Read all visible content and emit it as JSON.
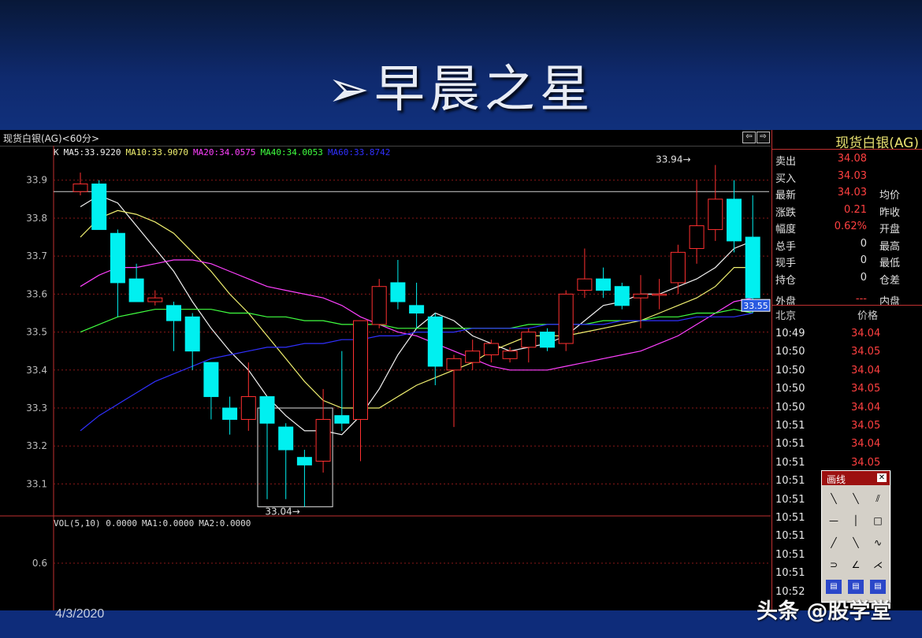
{
  "slide": {
    "title": "➢早晨之星",
    "date": "4/3/2020",
    "watermark": "头条 @股学堂"
  },
  "terminal": {
    "symbol_title": "现货白银(AG)<60分>",
    "nav_left_icon": "arrow-left-icon",
    "nav_right_icon": "arrow-right-icon",
    "ma_legend": [
      {
        "label": "K",
        "color": "#e0e0e0"
      },
      {
        "label": "MA5:33.9220",
        "color": "#f0f0f0"
      },
      {
        "label": "MA10:33.9070",
        "color": "#f0f070"
      },
      {
        "label": "MA20:34.0575",
        "color": "#ff40ff"
      },
      {
        "label": "MA40:34.0053",
        "color": "#40ff40"
      },
      {
        "label": "MA60:33.8742",
        "color": "#3030ff"
      }
    ],
    "vol_legend": [
      {
        "label": "VOL(5,10) 0.0000"
      },
      {
        "label": "MA1:0.0000"
      },
      {
        "label": "MA2:0.0000"
      }
    ],
    "last_price_tag": "33.55"
  },
  "chart_data": {
    "type": "candlestick",
    "title": "",
    "y_ticks": [
      33.9,
      33.8,
      33.7,
      33.6,
      33.5,
      33.4,
      33.3,
      33.2,
      33.1
    ],
    "ylim": [
      33.02,
      33.97
    ],
    "reference_price": 33.87,
    "annotations": [
      {
        "text": "33.94",
        "at_index": 33,
        "value": 33.94
      },
      {
        "text": "33.04",
        "at_index": 12,
        "value": 33.04
      }
    ],
    "candles": [
      {
        "o": 33.87,
        "h": 33.92,
        "l": 33.86,
        "c": 33.89
      },
      {
        "o": 33.89,
        "h": 33.9,
        "l": 33.77,
        "c": 33.77
      },
      {
        "o": 33.76,
        "h": 33.77,
        "l": 33.54,
        "c": 33.63
      },
      {
        "o": 33.64,
        "h": 33.68,
        "l": 33.58,
        "c": 33.58
      },
      {
        "o": 33.58,
        "h": 33.61,
        "l": 33.57,
        "c": 33.59
      },
      {
        "o": 33.57,
        "h": 33.58,
        "l": 33.45,
        "c": 33.53
      },
      {
        "o": 33.54,
        "h": 33.55,
        "l": 33.4,
        "c": 33.45
      },
      {
        "o": 33.42,
        "h": 33.42,
        "l": 33.27,
        "c": 33.33
      },
      {
        "o": 33.3,
        "h": 33.33,
        "l": 33.23,
        "c": 33.27
      },
      {
        "o": 33.27,
        "h": 33.42,
        "l": 33.24,
        "c": 33.33
      },
      {
        "o": 33.33,
        "h": 33.33,
        "l": 33.06,
        "c": 33.26
      },
      {
        "o": 33.25,
        "h": 33.26,
        "l": 33.06,
        "c": 33.19
      },
      {
        "o": 33.17,
        "h": 33.19,
        "l": 33.04,
        "c": 33.15
      },
      {
        "o": 33.16,
        "h": 33.35,
        "l": 33.13,
        "c": 33.27
      },
      {
        "o": 33.28,
        "h": 33.45,
        "l": 33.24,
        "c": 33.26
      },
      {
        "o": 33.27,
        "h": 33.53,
        "l": 33.16,
        "c": 33.53
      },
      {
        "o": 33.52,
        "h": 33.64,
        "l": 33.51,
        "c": 33.62
      },
      {
        "o": 33.63,
        "h": 33.69,
        "l": 33.56,
        "c": 33.58
      },
      {
        "o": 33.57,
        "h": 33.63,
        "l": 33.51,
        "c": 33.55
      },
      {
        "o": 33.54,
        "h": 33.55,
        "l": 33.36,
        "c": 33.41
      },
      {
        "o": 33.4,
        "h": 33.44,
        "l": 33.25,
        "c": 33.43
      },
      {
        "o": 33.42,
        "h": 33.48,
        "l": 33.4,
        "c": 33.45
      },
      {
        "o": 33.44,
        "h": 33.48,
        "l": 33.42,
        "c": 33.47
      },
      {
        "o": 33.43,
        "h": 33.46,
        "l": 33.42,
        "c": 33.45
      },
      {
        "o": 33.46,
        "h": 33.51,
        "l": 33.42,
        "c": 33.5
      },
      {
        "o": 33.5,
        "h": 33.51,
        "l": 33.45,
        "c": 33.46
      },
      {
        "o": 33.47,
        "h": 33.61,
        "l": 33.45,
        "c": 33.6
      },
      {
        "o": 33.61,
        "h": 33.72,
        "l": 33.59,
        "c": 33.64
      },
      {
        "o": 33.64,
        "h": 33.67,
        "l": 33.59,
        "c": 33.61
      },
      {
        "o": 33.62,
        "h": 33.63,
        "l": 33.56,
        "c": 33.57
      },
      {
        "o": 33.59,
        "h": 33.65,
        "l": 33.51,
        "c": 33.6
      },
      {
        "o": 33.6,
        "h": 33.64,
        "l": 33.56,
        "c": 33.6
      },
      {
        "o": 33.63,
        "h": 33.73,
        "l": 33.6,
        "c": 33.71
      },
      {
        "o": 33.72,
        "h": 33.9,
        "l": 33.68,
        "c": 33.78
      },
      {
        "o": 33.77,
        "h": 33.94,
        "l": 33.74,
        "c": 33.85
      },
      {
        "o": 33.85,
        "h": 33.9,
        "l": 33.71,
        "c": 33.74
      },
      {
        "o": 33.75,
        "h": 33.86,
        "l": 33.55,
        "c": 33.59
      }
    ],
    "series": [
      {
        "name": "MA5",
        "color": "#f0f0f0",
        "values": [
          33.83,
          33.86,
          33.84,
          33.78,
          33.72,
          33.66,
          33.58,
          33.51,
          33.45,
          33.4,
          33.33,
          33.28,
          33.24,
          33.24,
          33.23,
          33.28,
          33.35,
          33.44,
          33.51,
          33.55,
          33.53,
          33.49,
          33.47,
          33.45,
          33.46,
          33.47,
          33.49,
          33.53,
          33.57,
          33.58,
          33.6,
          33.6,
          33.62,
          33.64,
          33.67,
          33.72,
          33.74
        ]
      },
      {
        "name": "MA10",
        "color": "#f0f070",
        "values": [
          33.75,
          33.8,
          33.82,
          33.81,
          33.79,
          33.76,
          33.71,
          33.66,
          33.6,
          33.55,
          33.49,
          33.43,
          33.37,
          33.32,
          33.3,
          33.3,
          33.3,
          33.33,
          33.36,
          33.38,
          33.4,
          33.42,
          33.45,
          33.47,
          33.49,
          33.49,
          33.49,
          33.5,
          33.51,
          33.52,
          33.53,
          33.55,
          33.57,
          33.59,
          33.62,
          33.67,
          33.67
        ]
      },
      {
        "name": "MA20",
        "color": "#ff40ff",
        "values": [
          33.62,
          33.65,
          33.67,
          33.67,
          33.68,
          33.69,
          33.69,
          33.68,
          33.66,
          33.64,
          33.62,
          33.61,
          33.6,
          33.59,
          33.57,
          33.54,
          33.52,
          33.5,
          33.49,
          33.47,
          33.45,
          33.43,
          33.41,
          33.4,
          33.4,
          33.4,
          33.41,
          33.42,
          33.43,
          33.44,
          33.45,
          33.47,
          33.49,
          33.52,
          33.55,
          33.58,
          33.59
        ]
      },
      {
        "name": "MA40",
        "color": "#40ff40",
        "values": [
          33.5,
          33.52,
          33.54,
          33.55,
          33.56,
          33.56,
          33.56,
          33.56,
          33.55,
          33.55,
          33.54,
          33.54,
          33.53,
          33.53,
          33.52,
          33.52,
          33.52,
          33.51,
          33.51,
          33.51,
          33.51,
          33.51,
          33.51,
          33.51,
          33.52,
          33.52,
          33.52,
          33.52,
          33.53,
          33.53,
          33.53,
          33.54,
          33.54,
          33.55,
          33.55,
          33.56,
          33.55
        ]
      },
      {
        "name": "MA60",
        "color": "#3030ff",
        "values": [
          33.24,
          33.28,
          33.31,
          33.34,
          33.37,
          33.39,
          33.41,
          33.43,
          33.44,
          33.45,
          33.46,
          33.46,
          33.47,
          33.47,
          33.48,
          33.48,
          33.49,
          33.49,
          33.5,
          33.5,
          33.5,
          33.51,
          33.51,
          33.51,
          33.51,
          33.52,
          33.52,
          33.52,
          33.52,
          33.53,
          33.53,
          33.53,
          33.53,
          33.54,
          33.54,
          33.54,
          33.55
        ]
      }
    ],
    "vol_ticks": [
      0.6
    ]
  },
  "quote": {
    "title": "现货白银(AG)",
    "rows": [
      {
        "label": "卖出",
        "value": "34.08",
        "color": "#ff4040",
        "label2": ""
      },
      {
        "label": "买入",
        "value": "34.03",
        "color": "#ff4040",
        "label2": ""
      },
      {
        "label": "最新",
        "value": "34.03",
        "color": "#ff4040",
        "label2": "均价"
      },
      {
        "label": "涨跌",
        "value": "0.21",
        "color": "#ff4040",
        "label2": "昨收"
      },
      {
        "label": "幅度",
        "value": "0.62%",
        "color": "#ff4040",
        "label2": "开盘"
      },
      {
        "label": "总手",
        "value": "0",
        "color": "#e0e0e0",
        "label2": "最高"
      },
      {
        "label": "现手",
        "value": "0",
        "color": "#e0e0e0",
        "label2": "最低"
      },
      {
        "label": "持仓",
        "value": "0",
        "color": "#e0e0e0",
        "label2": "仓差"
      },
      {
        "label": "外盘",
        "value": "---",
        "color": "#ff4040",
        "label2": "内盘"
      }
    ],
    "tick_header": {
      "col1": "北京",
      "col2": "价格"
    },
    "ticks": [
      {
        "time": "10:49",
        "price": "34.04"
      },
      {
        "time": "10:50",
        "price": "34.05"
      },
      {
        "time": "10:50",
        "price": "34.04"
      },
      {
        "time": "10:50",
        "price": "34.05"
      },
      {
        "time": "10:50",
        "price": "34.04"
      },
      {
        "time": "10:51",
        "price": "34.05"
      },
      {
        "time": "10:51",
        "price": "34.04"
      },
      {
        "time": "10:51",
        "price": "34.05"
      },
      {
        "time": "10:51",
        "price": ""
      },
      {
        "time": "10:51",
        "price": ""
      },
      {
        "time": "10:51",
        "price": ""
      },
      {
        "time": "10:51",
        "price": ""
      },
      {
        "time": "10:51",
        "price": ""
      },
      {
        "time": "10:51",
        "price": ""
      },
      {
        "time": "10:52",
        "price": ""
      }
    ]
  },
  "draw_dialog": {
    "title": "画线",
    "close_icon": "close-icon",
    "tools": [
      "line-tool-icon",
      "ray-tool-icon",
      "parallel-tool-icon",
      "hline-tool-icon",
      "vline-tool-icon",
      "rect-tool-icon",
      "trend-tool-icon",
      "down-trend-tool-icon",
      "wave-tool-icon",
      "arc-tool-icon",
      "angle-tool-icon",
      "fan-tool-icon",
      "fib-tool-icon",
      "gann-tool-icon",
      "channel-tool-icon"
    ]
  }
}
